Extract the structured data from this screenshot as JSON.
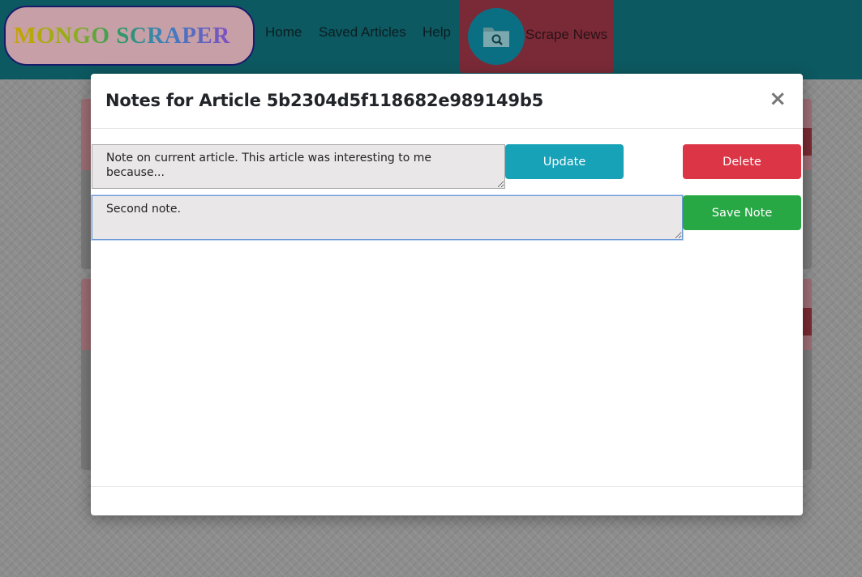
{
  "navbar": {
    "logo_text": "MONGO SCRAPER",
    "links": [
      "Home",
      "Saved Articles",
      "Help"
    ],
    "scrape_label": "Scrape News",
    "scrape_icon": "folder-search-icon"
  },
  "modal": {
    "title": "Notes for Article 5b2304d5f118682e989149b5",
    "close_symbol": "×",
    "notes": [
      {
        "text": "Note on current article. This article was interesting to me because..."
      }
    ],
    "new_note_value": "Second note.",
    "update_label": "Update",
    "delete_label": "Delete",
    "save_label": "Save Note"
  },
  "colors": {
    "navbar": "#0d5961",
    "update": "#17a2b8",
    "delete": "#dc3545",
    "save": "#28a745"
  }
}
